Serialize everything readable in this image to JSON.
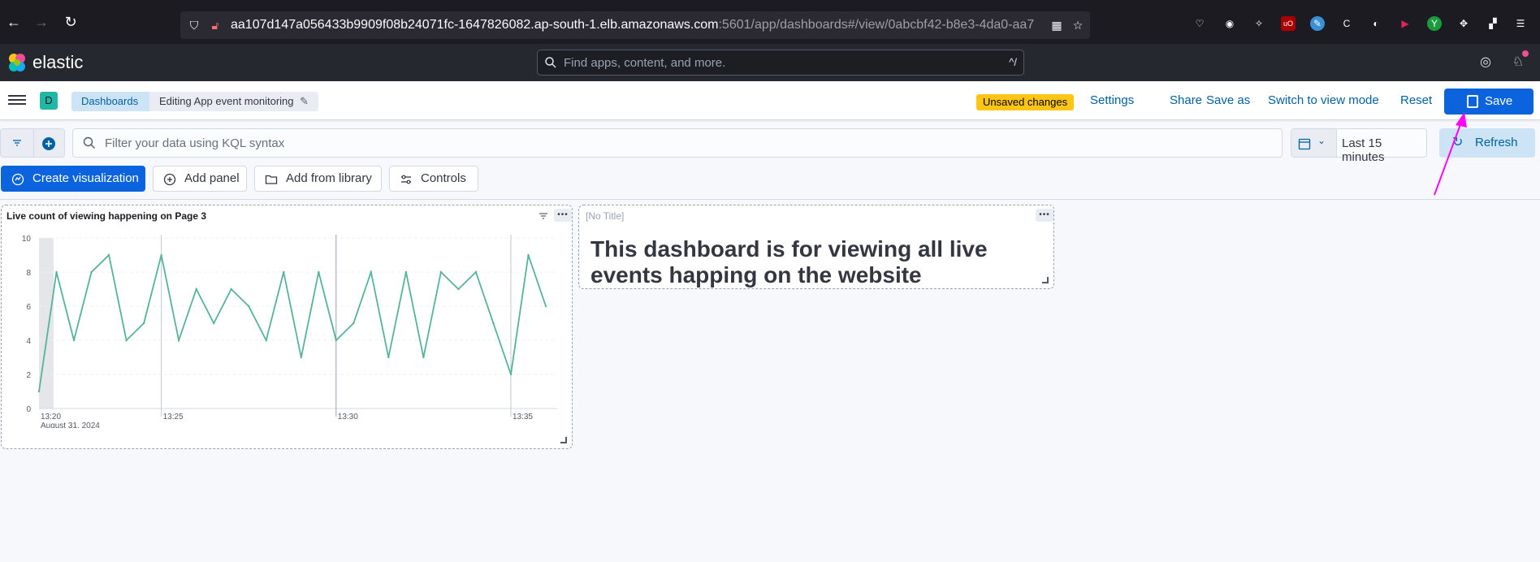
{
  "browser": {
    "url_host": "aa107d147a056433b9909f08b24071fc-1647826082.ap-south-1.elb.amazonaws.com",
    "url_rest": ":5601/app/dashboards#/view/0abcbf42-b8e3-4da0-aa7"
  },
  "header": {
    "brand": "elastic",
    "search_placeholder": "Find apps, content, and more.",
    "search_shortcut": "^/"
  },
  "breadcrumbs": {
    "space": "D",
    "dashboards": "Dashboards",
    "current": "Editing App event monitoring"
  },
  "top_nav": {
    "unsaved": "Unsaved changes",
    "settings": "Settings",
    "share": "Share",
    "save_as": "Save as",
    "switch_mode": "Switch to view mode",
    "reset": "Reset",
    "save": "Save"
  },
  "query_bar": {
    "placeholder": "Filter your data using KQL syntax",
    "time_range": "Last 15 minutes",
    "refresh": "Refresh"
  },
  "panel_toolbar": {
    "create_visualization": "Create visualization",
    "add_panel": "Add panel",
    "add_from_library": "Add from library",
    "controls": "Controls"
  },
  "panels": {
    "chart_title": "Live count of viewing happening on Page 3",
    "markdown_title": "[No Title]",
    "markdown_text": "This dashboard is for viewing all live events happing on the website"
  },
  "colors": {
    "line": "#54b399",
    "accent": "#0b64dd",
    "annotation": "#ff00ff"
  },
  "chart_data": {
    "type": "line",
    "title": "Live count of viewing happening on Page 3",
    "x_date_label": "August 31, 2024",
    "x_ticks": [
      "13:20",
      "13:25",
      "13:30",
      "13:35"
    ],
    "y_ticks": [
      "0",
      "2",
      "4",
      "6",
      "8",
      "10"
    ],
    "ylim": [
      0,
      10
    ],
    "grid": true,
    "series": [
      {
        "values": [
          1,
          8,
          4,
          8,
          9,
          4,
          5,
          9,
          4,
          7,
          5,
          7,
          6,
          4,
          8,
          3,
          8,
          4,
          5,
          8,
          3,
          8,
          3,
          8,
          7,
          8,
          5,
          2,
          9,
          6
        ]
      }
    ]
  }
}
